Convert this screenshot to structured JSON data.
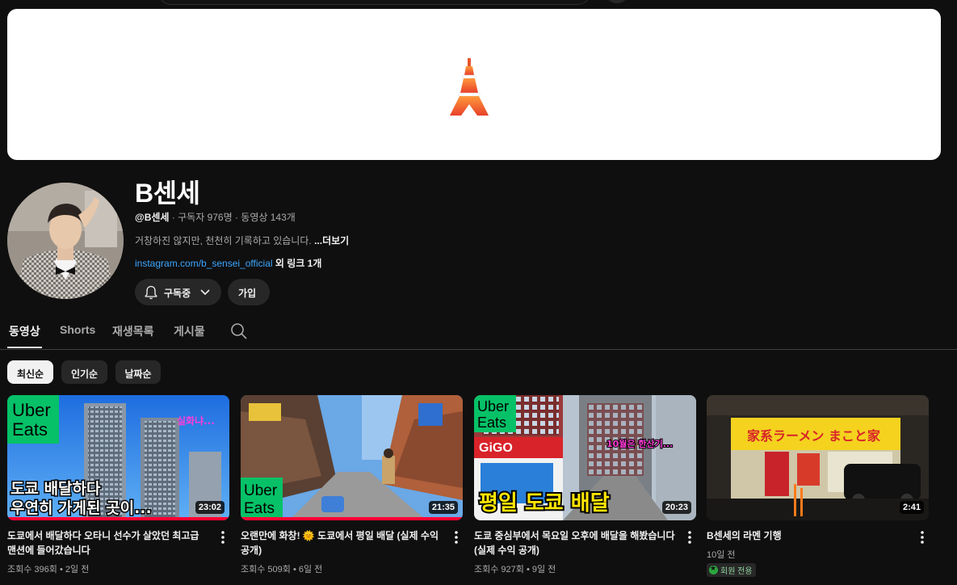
{
  "channel": {
    "name": "B센세",
    "handle": "@B센세",
    "stats": " · 구독자 976명 · 동영상 143개",
    "description": "거창하진 않지만, 천천히 기록하고 있습니다. ",
    "more_label": "...더보기",
    "link_url": "instagram.com/b_sensei_official",
    "link_extra": " 외 링크 1개",
    "subscribe_label": "구독중",
    "join_label": "가입"
  },
  "tabs": [
    {
      "label": "동영상",
      "active": true
    },
    {
      "label": "Shorts"
    },
    {
      "label": "재생목록"
    },
    {
      "label": "게시물"
    }
  ],
  "chips": [
    {
      "label": "최신순",
      "active": true
    },
    {
      "label": "인기순"
    },
    {
      "label": "날짜순"
    }
  ],
  "videos": [
    {
      "title": "도쿄에서 배달하다 오타니 선수가 살았던 최고급 맨션에 들어갔습니다",
      "meta": "조회수 396회 • 2일 전",
      "duration": "23:02",
      "progress": 1.0,
      "thumb_text_1": "도쿄 배달하다",
      "thumb_text_2": "우연히 가게된 곳이...",
      "thumb_tag": "실화냐...",
      "logo_1": "Uber",
      "logo_2": "Eats"
    },
    {
      "title": "오랜만에 화창! 🌞 도쿄에서 평일 배달 (실제 수익 공개)",
      "meta": "조회수 509회 • 6일 전",
      "duration": "21:35",
      "progress": 1.0,
      "logo_1": "Uber",
      "logo_2": "Eats"
    },
    {
      "title": "도쿄 중심부에서 목요일 오후에 배달을 해봤습니다 (실제 수익 공개)",
      "meta": "조회수 927회 • 9일 전",
      "duration": "20:23",
      "progress": 0,
      "thumb_text_1": "평일 도쿄 배달",
      "thumb_tag": "10월은 한산기...",
      "store_sign": "GiGO",
      "logo_1": "Uber",
      "logo_2": "Eats"
    },
    {
      "title": "B센세의 라멘 기행",
      "meta": "10일 전",
      "duration": "2:41",
      "progress": 0,
      "badge": "회원 전용",
      "shop_sign": "家系ラーメン まこと家"
    }
  ],
  "colors": {
    "background": "#0f0f0f",
    "link": "#3ea6ff",
    "progress": "#ff0033",
    "uber_green": "#06c167",
    "member_green": "#2ba640"
  }
}
